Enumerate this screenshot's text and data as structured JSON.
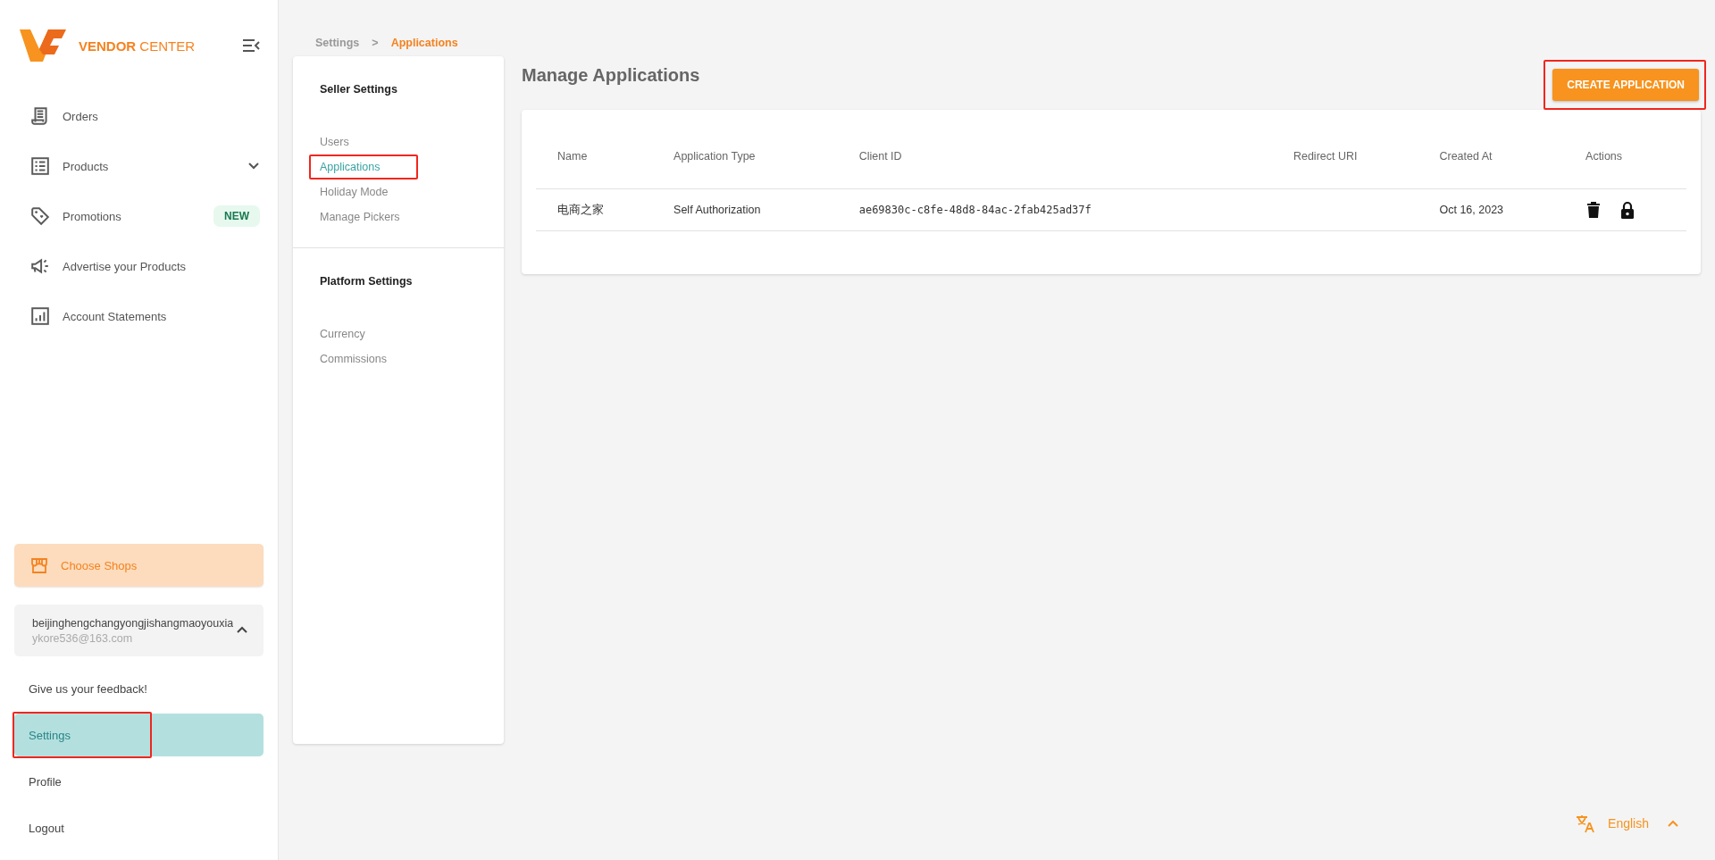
{
  "sidebar": {
    "brand": {
      "bold": "VENDOR",
      "light": "CENTER"
    },
    "nav_items": [
      {
        "kind": "orders",
        "label": "Orders"
      },
      {
        "kind": "products",
        "label": "Products",
        "expanded": false
      },
      {
        "kind": "promotions",
        "label": "Promotions",
        "badge": "NEW"
      },
      {
        "kind": "advertise",
        "label": "Advertise your Products"
      },
      {
        "kind": "statements",
        "label": "Account Statements"
      }
    ],
    "shop_button": "Choose Shops",
    "account": {
      "name": "beijinghengchangyongjishangmaoyouxia",
      "email": "ykore536@163.com",
      "expanded": true
    },
    "links": [
      {
        "label": "Give us your feedback!",
        "selected": false,
        "highlighted": false
      },
      {
        "label": "Settings",
        "selected": true,
        "highlighted": true
      },
      {
        "label": "Profile",
        "selected": false,
        "highlighted": false
      },
      {
        "label": "Logout",
        "selected": false,
        "highlighted": false
      }
    ]
  },
  "breadcrumb": {
    "items": [
      "Settings",
      "Applications"
    ],
    "separator": ">"
  },
  "settings_menu": [
    {
      "title": "Seller Settings",
      "items": [
        {
          "label": "Users",
          "selected": false,
          "highlighted": false
        },
        {
          "label": "Applications",
          "selected": true,
          "highlighted": true
        },
        {
          "label": "Holiday Mode",
          "selected": false,
          "highlighted": false
        },
        {
          "label": "Manage Pickers",
          "selected": false,
          "highlighted": false
        }
      ]
    },
    {
      "title": "Platform Settings",
      "items": [
        {
          "label": "Currency",
          "selected": false,
          "highlighted": false
        },
        {
          "label": "Commissions",
          "selected": false,
          "highlighted": false
        }
      ]
    }
  ],
  "main": {
    "title": "Manage Applications",
    "create_button": {
      "label": "CREATE APPLICATION",
      "highlighted": true
    },
    "table": {
      "columns": [
        "Name",
        "Application Type",
        "Client ID",
        "Redirect URI",
        "Created At",
        "Actions"
      ],
      "rows": [
        {
          "cells": [
            "电商之家",
            "Self Authorization",
            "ae69830c-c8fe-48d8-84ac-2fab425ad37f",
            "",
            "Oct 16, 2023"
          ]
        }
      ]
    }
  },
  "language": {
    "label": "English"
  }
}
